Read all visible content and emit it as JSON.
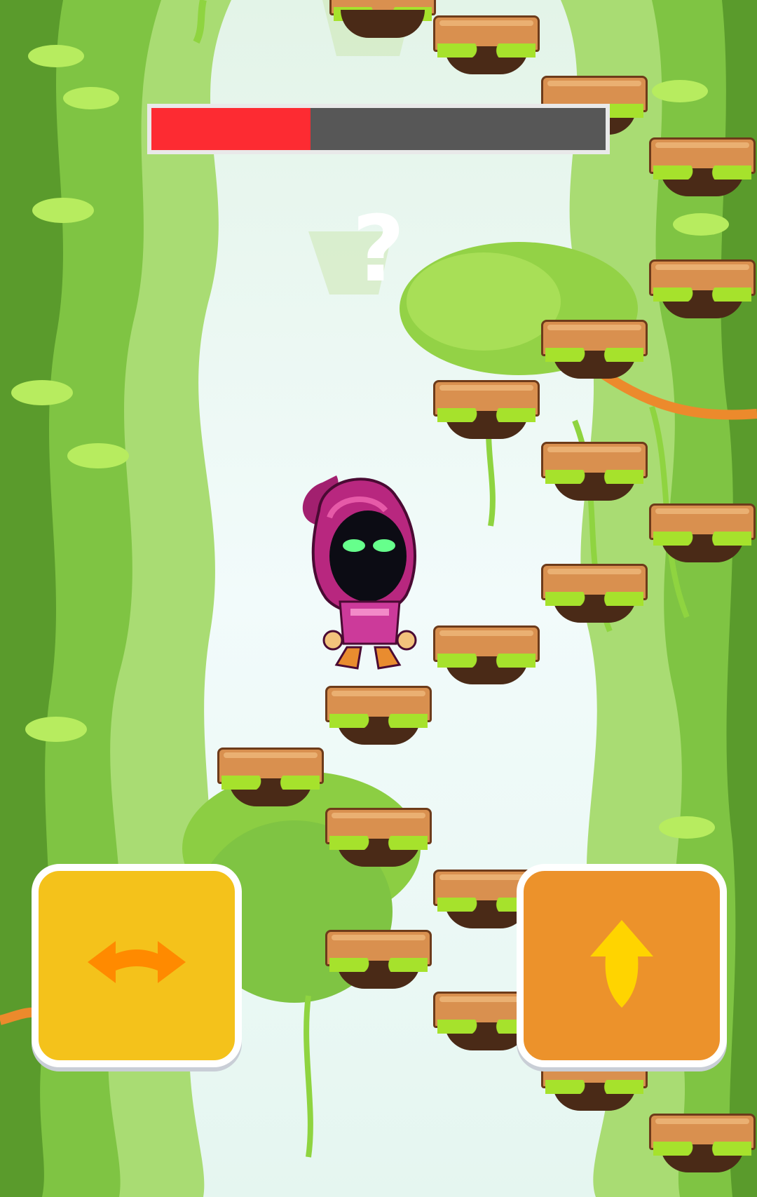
{
  "game": {
    "score_text": "?",
    "timer_fraction": 0.35
  },
  "colors": {
    "timer_fill": "#fd2b32",
    "timer_track": "#575757",
    "move_button": "#f4c21b",
    "jump_button": "#ec922b"
  },
  "controls": {
    "move_icon": "left-right-arrow-icon",
    "jump_icon": "up-arrow-icon"
  },
  "character": {
    "icon": "hooded-wizard-icon"
  }
}
